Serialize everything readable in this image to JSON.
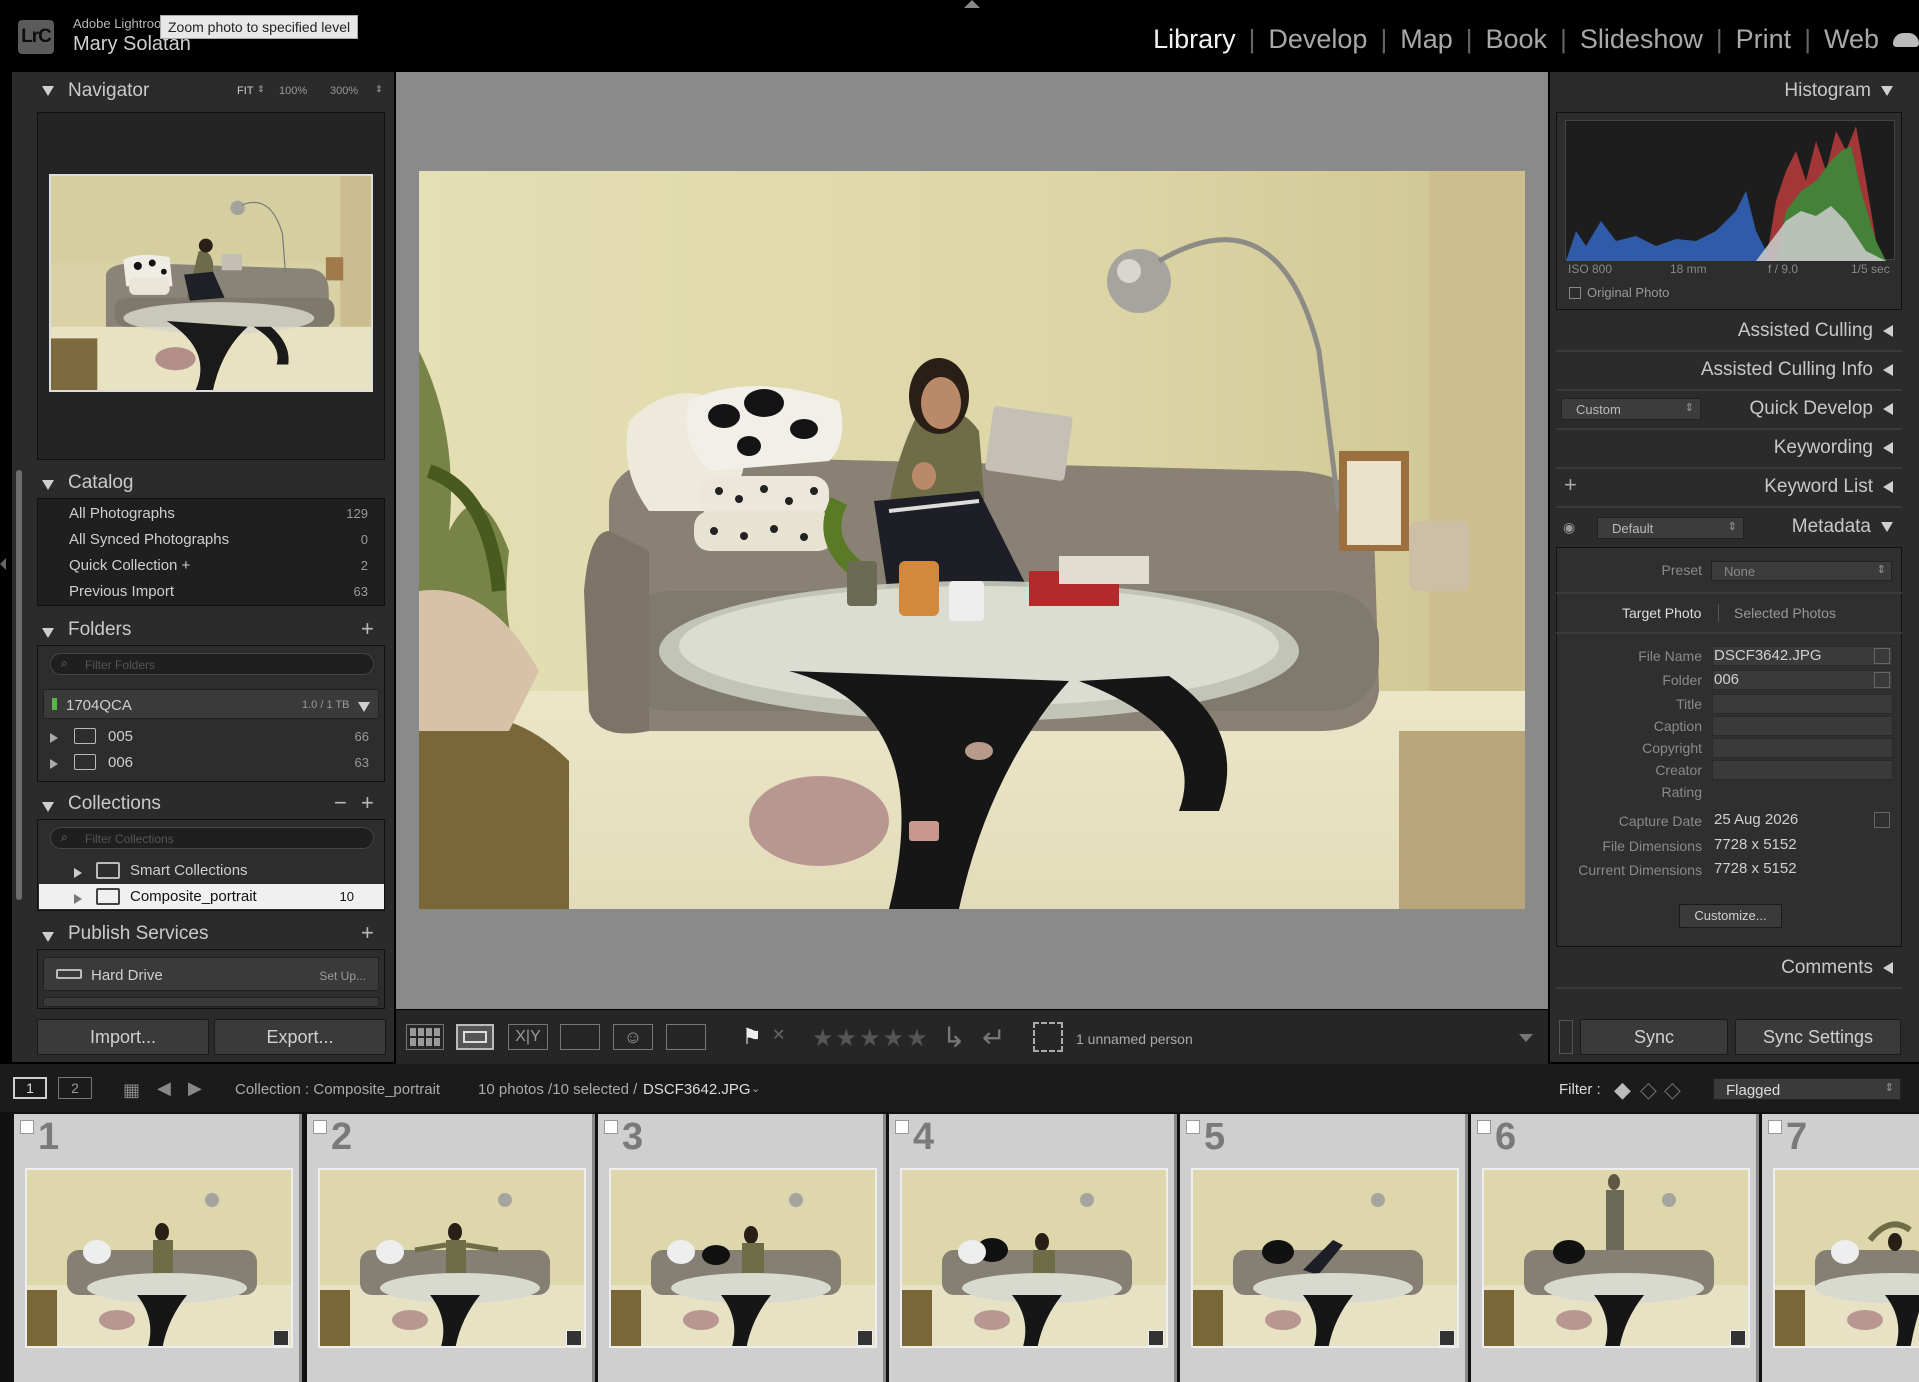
{
  "app": {
    "logo_text": "LrC",
    "app_name": "Adobe Lightroom",
    "user_name": "Mary Solatan",
    "tooltip": "Zoom photo to specified level"
  },
  "modules": [
    "Library",
    "Develop",
    "Map",
    "Book",
    "Slideshow",
    "Print",
    "Web"
  ],
  "active_module": "Library",
  "navigator": {
    "title": "Navigator",
    "zoom_options": [
      "FIT",
      "100%",
      "300%"
    ]
  },
  "catalog": {
    "title": "Catalog",
    "items": [
      {
        "label": "All Photographs",
        "count": "129"
      },
      {
        "label": "All Synced Photographs",
        "count": "0"
      },
      {
        "label": "Quick Collection +",
        "count": "2"
      },
      {
        "label": "Previous Import",
        "count": "63"
      }
    ]
  },
  "folders": {
    "title": "Folders",
    "filter_placeholder": "Filter Folders",
    "volume": {
      "name": "1704QCA",
      "usage": "1.0 / 1 TB"
    },
    "items": [
      {
        "name": "005",
        "count": "66"
      },
      {
        "name": "006",
        "count": "63"
      }
    ]
  },
  "collections": {
    "title": "Collections",
    "filter_placeholder": "Filter Collections",
    "items": [
      {
        "name": "Smart Collections",
        "count": ""
      },
      {
        "name": "Composite_portrait",
        "count": "10"
      }
    ]
  },
  "publish": {
    "title": "Publish Services",
    "items": [
      {
        "name": "Hard Drive",
        "action": "Set Up..."
      }
    ]
  },
  "left_buttons": {
    "import": "Import...",
    "export": "Export..."
  },
  "toolbar": {
    "people_label": "1 unnamed person"
  },
  "histogram": {
    "title": "Histogram",
    "iso": "ISO 800",
    "focal": "18 mm",
    "aperture": "f / 9.0",
    "shutter": "1/5 sec",
    "original_photo": "Original Photo"
  },
  "right_sections": {
    "assisted_culling": "Assisted Culling",
    "assisted_culling_info": "Assisted Culling Info",
    "quick_develop": "Quick Develop",
    "quick_develop_preset": "Custom",
    "keywording": "Keywording",
    "keyword_list": "Keyword List",
    "metadata": "Metadata",
    "metadata_preset_select": "Default",
    "comments": "Comments"
  },
  "metadata": {
    "preset_label": "Preset",
    "preset_value": "None",
    "tab_target": "Target Photo",
    "tab_selected": "Selected Photos",
    "fields": {
      "file_name": {
        "label": "File Name",
        "value": "DSCF3642.JPG"
      },
      "folder": {
        "label": "Folder",
        "value": "006"
      },
      "title": {
        "label": "Title",
        "value": ""
      },
      "caption": {
        "label": "Caption",
        "value": ""
      },
      "copyright": {
        "label": "Copyright",
        "value": ""
      },
      "creator": {
        "label": "Creator",
        "value": ""
      },
      "rating": {
        "label": "Rating",
        "value": ""
      },
      "capture_date": {
        "label": "Capture Date",
        "value": "25 Aug 2026"
      },
      "file_dimensions": {
        "label": "File Dimensions",
        "value": "7728 x 5152"
      },
      "current_dimensions": {
        "label": "Current Dimensions",
        "value": "7728 x 5152"
      }
    },
    "customize": "Customize..."
  },
  "sync": {
    "sync": "Sync",
    "sync_settings": "Sync Settings"
  },
  "filmbar": {
    "screen1": "1",
    "screen2": "2",
    "collection": "Collection : Composite_portrait",
    "selection": "10 photos /10 selected /",
    "current_file": "DSCF3642.JPG",
    "filter_label": "Filter :",
    "filter_value": "Flagged"
  },
  "filmstrip": [
    "1",
    "2",
    "3",
    "4",
    "5",
    "6",
    "7"
  ],
  "colors": {
    "accent": "#f2f2f2",
    "panel": "#2b2b2b",
    "center_bg": "#8a8a8a",
    "selected_row": "#f0f0f0"
  }
}
